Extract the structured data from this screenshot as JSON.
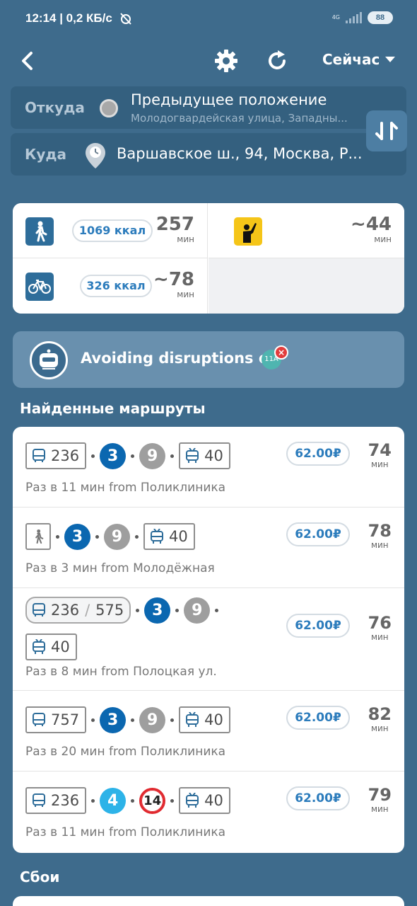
{
  "status_bar": {
    "time": "12:14 | 0,2 КБ/с",
    "network": "4G",
    "battery": "88"
  },
  "toolbar": {
    "when": "Сейчас"
  },
  "from": {
    "label": "Откуда",
    "title": "Предыдущее положение",
    "subtitle": "Молодогвардейская улица, Западны..."
  },
  "to": {
    "label": "Куда",
    "title": "Варшавское ш., 94, Москва, Р..."
  },
  "modes": {
    "walk": {
      "kcal": "1069 ккал",
      "time": "257",
      "unit": "мин"
    },
    "bike": {
      "kcal": "326 ккал",
      "time": "~78",
      "unit": "мин"
    },
    "taxi": {
      "time": "~44",
      "unit": "мин"
    }
  },
  "banner": {
    "text": "Avoiding disruptions on",
    "badge": "11A"
  },
  "sections": {
    "routes_title": "Найденные маршруты",
    "disruptions_title": "Сбои"
  },
  "routes": [
    {
      "bus": "236",
      "metro_a": "3",
      "metro_b": "9",
      "trolley": "40",
      "price": "62.00₽",
      "time": "74",
      "unit": "мин",
      "freq": "Раз в 11 мин from Поликлиника"
    },
    {
      "metro_a": "3",
      "metro_b": "9",
      "trolley": "40",
      "price": "62.00₽",
      "time": "78",
      "unit": "мин",
      "freq": "Раз в 3 мин from Молодёжная"
    },
    {
      "bus": "236",
      "bus_alt": "575",
      "metro_a": "3",
      "metro_b": "9",
      "trolley": "40",
      "price": "62.00₽",
      "time": "76",
      "unit": "мин",
      "freq": "Раз в 8 мин from Полоцкая ул."
    },
    {
      "bus": "757",
      "metro_a": "3",
      "metro_b": "9",
      "trolley": "40",
      "price": "62.00₽",
      "time": "82",
      "unit": "мин",
      "freq": "Раз в 20 мин from Поликлиника"
    },
    {
      "bus": "236",
      "metro_a": "4",
      "metro_b": "14",
      "trolley": "40",
      "price": "62.00₽",
      "time": "79",
      "unit": "мин",
      "freq": "Раз в 11 мин from Поликлиника"
    }
  ],
  "colors": {
    "background": "#3e6b8c",
    "accent": "#2c7cbc",
    "metro_3": "#0b67b0",
    "metro_9": "#9e9e9e",
    "metro_4": "#2db3e8",
    "mcc_14": "#e0282e",
    "taxi": "#f5c518"
  }
}
